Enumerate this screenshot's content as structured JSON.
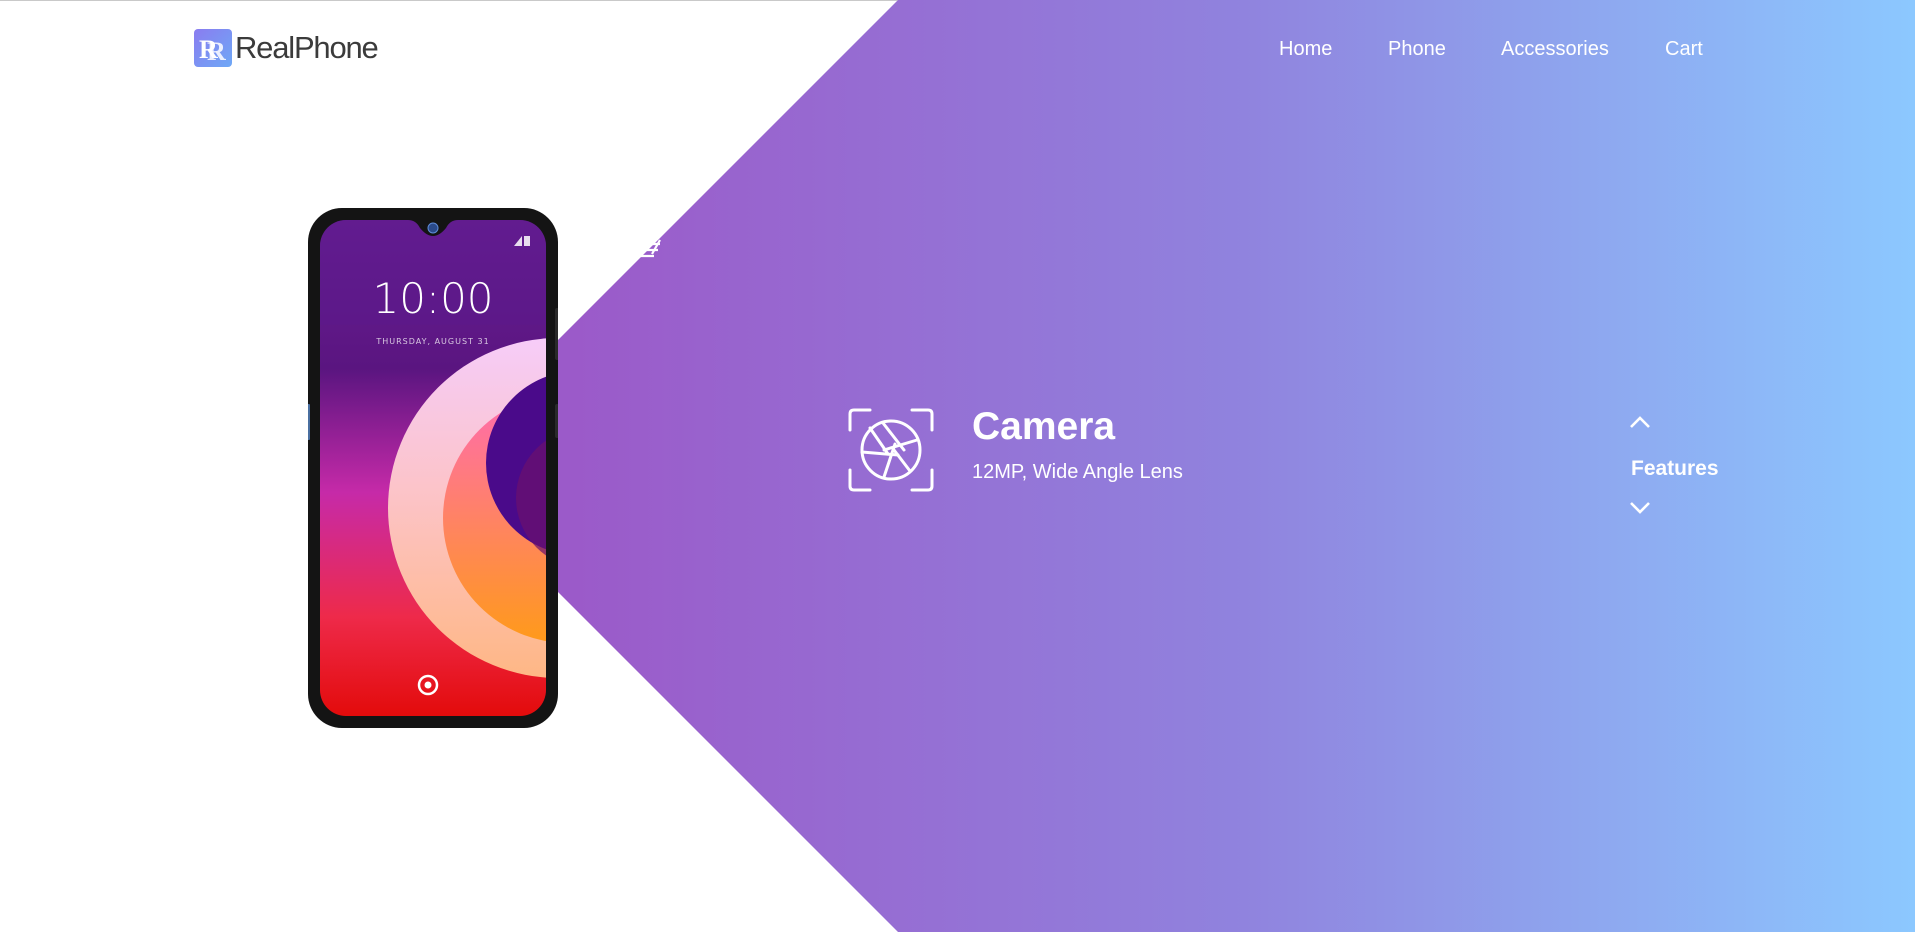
{
  "brand": {
    "name": "RealPhone",
    "logo_icon": "realphone-logo-icon"
  },
  "nav": {
    "items": [
      "Home",
      "Phone",
      "Accessories",
      "Cart"
    ]
  },
  "phone": {
    "clock_time": "10:00",
    "clock_date": "THURSDAY, AUGUST 31"
  },
  "feature": {
    "icon": "camera-aperture-icon",
    "title": "Camera",
    "description": "12MP, Wide Angle Lens"
  },
  "features_nav": {
    "label": "Features",
    "up_icon": "chevron-up-icon",
    "down_icon": "chevron-down-icon"
  },
  "colors": {
    "gradient_start": "#9b5ac9",
    "gradient_mid": "#9083de",
    "gradient_end": "#8cc8ff",
    "text_on_gradient": "#ffffff",
    "logo_text": "#3b3b3b"
  }
}
